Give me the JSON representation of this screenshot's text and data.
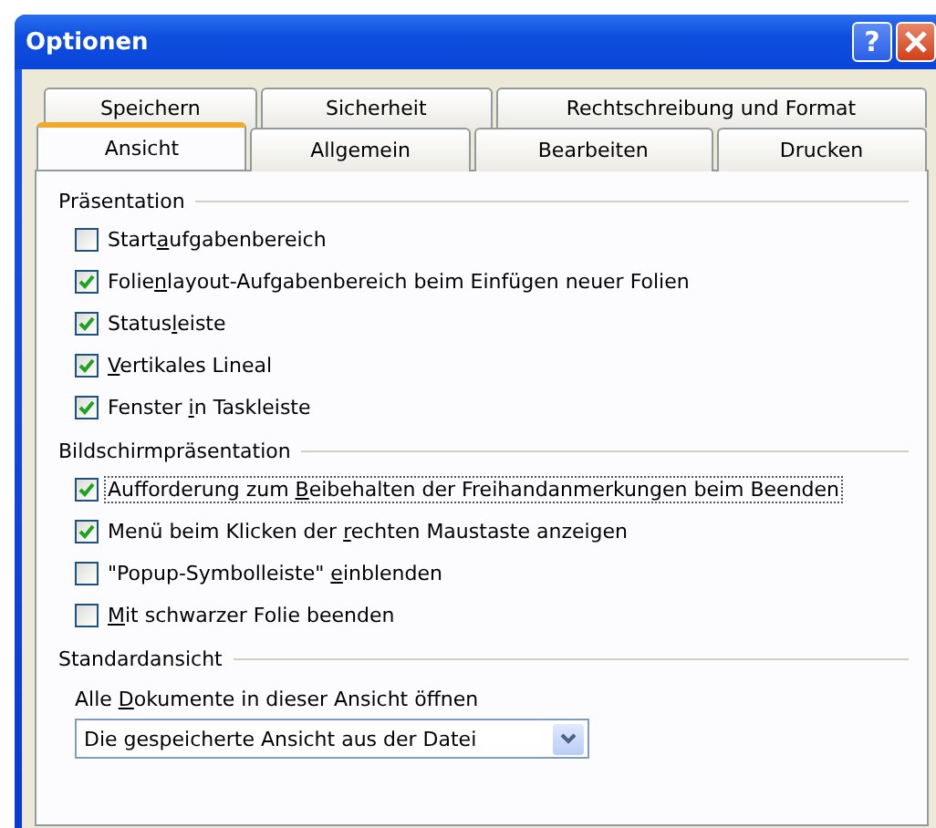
{
  "window": {
    "title": "Optionen",
    "buttons": [
      {
        "kind": "help",
        "label": "?"
      },
      {
        "kind": "close"
      }
    ]
  },
  "tab_rows": [
    [
      {
        "label": "Speichern",
        "selected": false
      },
      {
        "label": "Sicherheit",
        "selected": false
      },
      {
        "label": "Rechtschreibung und Format",
        "selected": false
      }
    ],
    [
      {
        "label": "Ansicht",
        "selected": true
      },
      {
        "label": "Allgemein",
        "selected": false
      },
      {
        "label": "Bearbeiten",
        "selected": false
      },
      {
        "label": "Drucken",
        "selected": false
      }
    ]
  ],
  "groups": [
    {
      "title": "Präsentation",
      "options": [
        {
          "label": {
            "before": "Start",
            "key": "a",
            "after": "ufgabenbereich"
          },
          "checked": false,
          "focused": false
        },
        {
          "label": {
            "before": "Folie",
            "key": "n",
            "after": "layout-Aufgabenbereich beim Einfügen neuer Folien"
          },
          "checked": true,
          "focused": false
        },
        {
          "label": {
            "before": "Status",
            "key": "l",
            "after": "eiste"
          },
          "checked": true,
          "focused": false
        },
        {
          "label": {
            "key": "V",
            "after": "ertikales Lineal"
          },
          "checked": true,
          "focused": false
        },
        {
          "label": {
            "before": "Fenster ",
            "key": "i",
            "after": "n Taskleiste"
          },
          "checked": true,
          "focused": false
        }
      ]
    },
    {
      "title": "Bildschirmpräsentation",
      "options": [
        {
          "label": {
            "before": "Aufforderung zum ",
            "key": "B",
            "after": "eibehalten der Freihandanmerkungen beim Beenden"
          },
          "checked": true,
          "focused": true
        },
        {
          "label": {
            "before": "Menü beim Klicken der ",
            "key": "r",
            "after": "echten Maustaste anzeigen"
          },
          "checked": true,
          "focused": false
        },
        {
          "label": {
            "before": "\"Popup-Symbolleiste\" ",
            "key": "e",
            "after": "inblenden"
          },
          "checked": false,
          "focused": false
        },
        {
          "label": {
            "key": "M",
            "after": "it schwarzer Folie beenden"
          },
          "checked": false,
          "focused": false
        }
      ]
    },
    {
      "title": "Standardansicht",
      "select": {
        "label": {
          "before": "Alle ",
          "key": "D",
          "after": "okumente in dieser Ansicht öffnen"
        },
        "value": "Die gespeicherte Ansicht aus der Datei"
      }
    }
  ]
}
